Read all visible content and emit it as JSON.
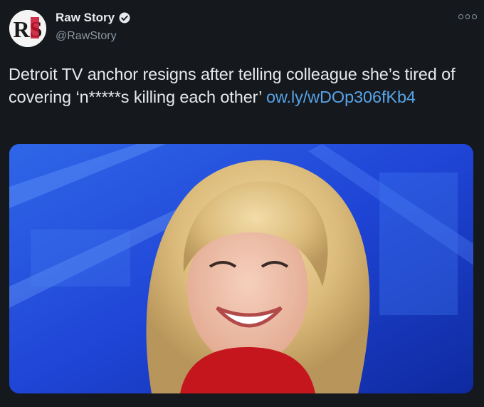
{
  "account": {
    "display_name": "Raw Story",
    "handle": "@RawStory",
    "logo_text": "RS"
  },
  "tweet": {
    "text": "Detroit TV anchor resigns after telling colleague she’s tired of covering ‘n*****s killing each other’ ",
    "link_text": "ow.ly/wDOp306fKb4"
  },
  "icons": {
    "verified": "verified-badge-icon",
    "more": "more-options-icon"
  },
  "colors": {
    "background": "#15181c",
    "text": "#e8eaed",
    "secondary": "#8b98a5",
    "link": "#57a4e8",
    "logo_red": "#c8102e",
    "media_blue": "#1a3fcf"
  }
}
